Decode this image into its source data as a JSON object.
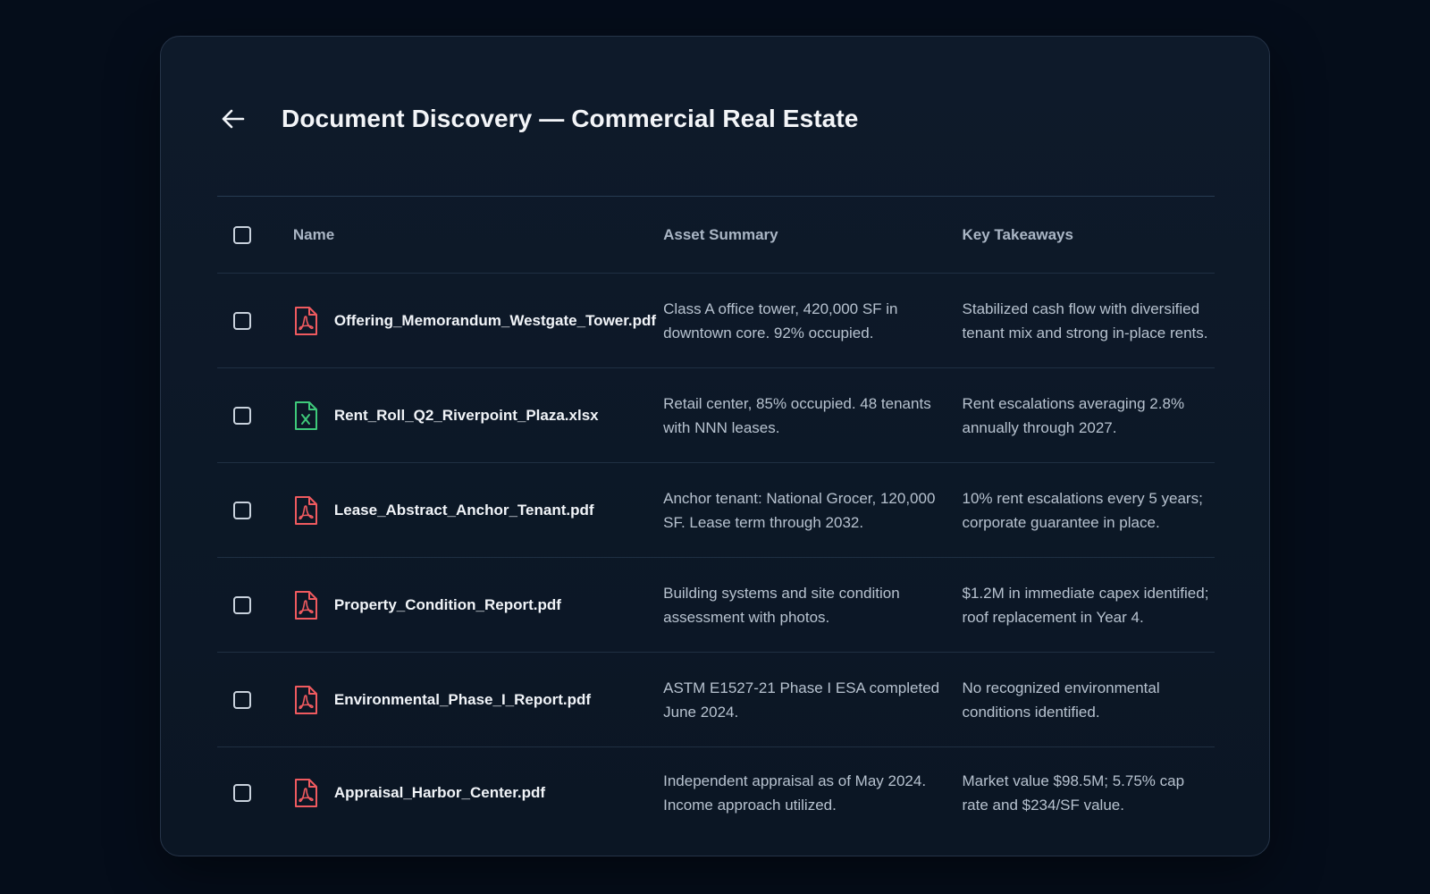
{
  "header": {
    "title": "Document Discovery — Commercial Real Estate",
    "back_icon": "arrow-left-icon"
  },
  "colors": {
    "pdf": "#ef5a5f",
    "xlsx": "#3ec97a"
  },
  "table": {
    "columns": [
      "Name",
      "Asset Summary",
      "Key Takeaways"
    ],
    "rows": [
      {
        "name": "Offering_Memorandum_Westgate_Tower.pdf",
        "icon": "pdf-file-icon",
        "summary": "Class A office tower, 420,000 SF in downtown core. 92% occupied.",
        "takeaways": "Stabilized cash flow with diversified tenant mix and strong in-place rents."
      },
      {
        "name": "Rent_Roll_Q2_Riverpoint_Plaza.xlsx",
        "icon": "spreadsheet-file-icon",
        "summary": "Retail center, 85% occupied. 48 tenants with NNN leases.",
        "takeaways": "Rent escalations averaging 2.8% annually through 2027."
      },
      {
        "name": "Lease_Abstract_Anchor_Tenant.pdf",
        "icon": "pdf-file-icon",
        "summary": "Anchor tenant: National Grocer, 120,000 SF. Lease term through 2032.",
        "takeaways": "10% rent escalations every 5 years; corporate guarantee in place."
      },
      {
        "name": "Property_Condition_Report.pdf",
        "icon": "pdf-file-icon",
        "summary": "Building systems and site condition assessment with photos.",
        "takeaways": "$1.2M in immediate capex identified; roof replacement in Year 4."
      },
      {
        "name": "Environmental_Phase_I_Report.pdf",
        "icon": "pdf-file-icon",
        "summary": "ASTM E1527-21 Phase I ESA completed June 2024.",
        "takeaways": "No recognized environmental conditions identified."
      },
      {
        "name": "Appraisal_Harbor_Center.pdf",
        "icon": "pdf-file-icon",
        "summary": "Independent appraisal as of May 2024. Income approach utilized.",
        "takeaways": "Market value $98.5M; 5.75% cap rate and $234/SF value."
      }
    ]
  }
}
